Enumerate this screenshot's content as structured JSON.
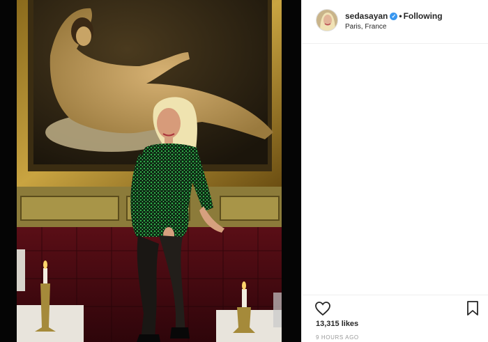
{
  "post": {
    "username": "sedasayan",
    "verified_mark": "✓",
    "separator": "•",
    "follow_status": "Following",
    "location": "Paris, France",
    "likes": "13,315 likes",
    "timestamp": "9 HOURS AGO"
  },
  "icons": {
    "like": "heart-icon",
    "save": "bookmark-icon",
    "verified": "verified-badge-icon"
  },
  "colors": {
    "verified_blue": "#3897f0",
    "text": "#262626",
    "muted": "#999999",
    "divider": "#efefef"
  }
}
